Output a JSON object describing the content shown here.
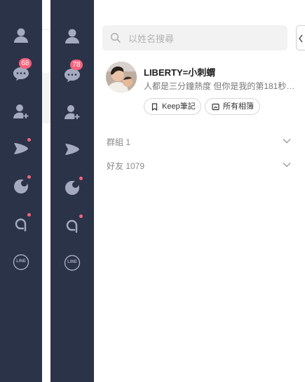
{
  "sidebar": {
    "chat_badge_back": "68",
    "chat_badge_front": "78",
    "items": [
      {
        "name": "friends",
        "icon": "person-icon"
      },
      {
        "name": "chats",
        "icon": "chat-bubble-icon"
      },
      {
        "name": "add-friends",
        "icon": "add-person-icon"
      },
      {
        "name": "voom",
        "icon": "voom-play-icon"
      },
      {
        "name": "openchat",
        "icon": "openchat-icon"
      },
      {
        "name": "today",
        "icon": "today-a-icon"
      },
      {
        "name": "line",
        "icon": "line-logo-icon"
      }
    ],
    "line_logo_text": "LINE"
  },
  "search": {
    "placeholder": "以姓名搜尋"
  },
  "profile": {
    "name": "LIBERTY=小刺蝟",
    "status": "人都是三分鐘熱度  但你是我的第181秒…",
    "keep_label": "Keep筆記",
    "album_label": "所有相簿"
  },
  "sections": {
    "groups_label": "群組 1",
    "friends_label": "好友 1079"
  },
  "colors": {
    "rail": "#2b3349",
    "icon": "#a4abc0",
    "badge": "#f5647c"
  }
}
